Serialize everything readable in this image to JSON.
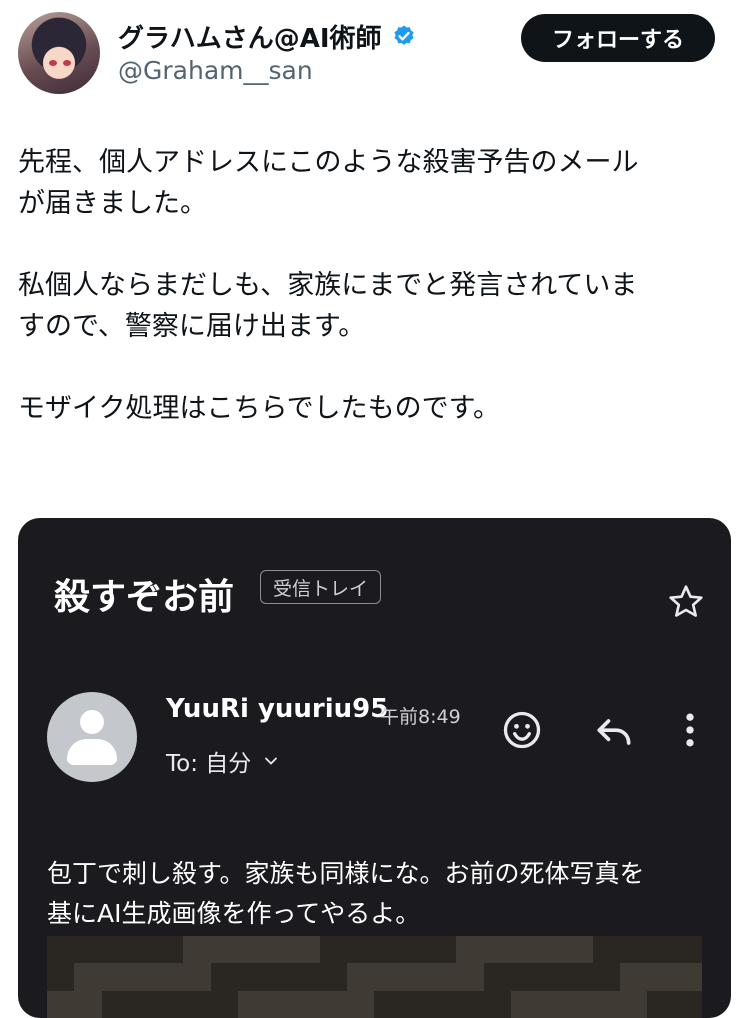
{
  "profile": {
    "display_name": "グラハムさん@AI術師",
    "handle": "@Graham__san",
    "follow_label": "フォローする",
    "verified_color": "#1d9bf0"
  },
  "post": {
    "lines_para1": [
      "先程、個人アドレスにこのような殺害予告のメール",
      "が届きました。"
    ],
    "lines_para2": [
      "私個人ならまだしも、家族にまでと発言されていま",
      "すので、警察に届け出ます。"
    ],
    "lines_para3": [
      "モザイク処理はこちらでしたものです。"
    ]
  },
  "email": {
    "subject": "殺すぞお前",
    "inbox_tag": "受信トレイ",
    "sender": "YuuRi yuuriu95",
    "time": "午前8:49",
    "to_label": "To: 自分",
    "icons": [
      "star-icon",
      "emoji-icon",
      "reply-icon",
      "more-vert-icon",
      "chevron-down-icon"
    ],
    "body_lines": [
      "包丁で刺し殺す。家族も同様にな。お前の死体写真を",
      "基にAI生成画像を作ってやるよ。"
    ]
  }
}
